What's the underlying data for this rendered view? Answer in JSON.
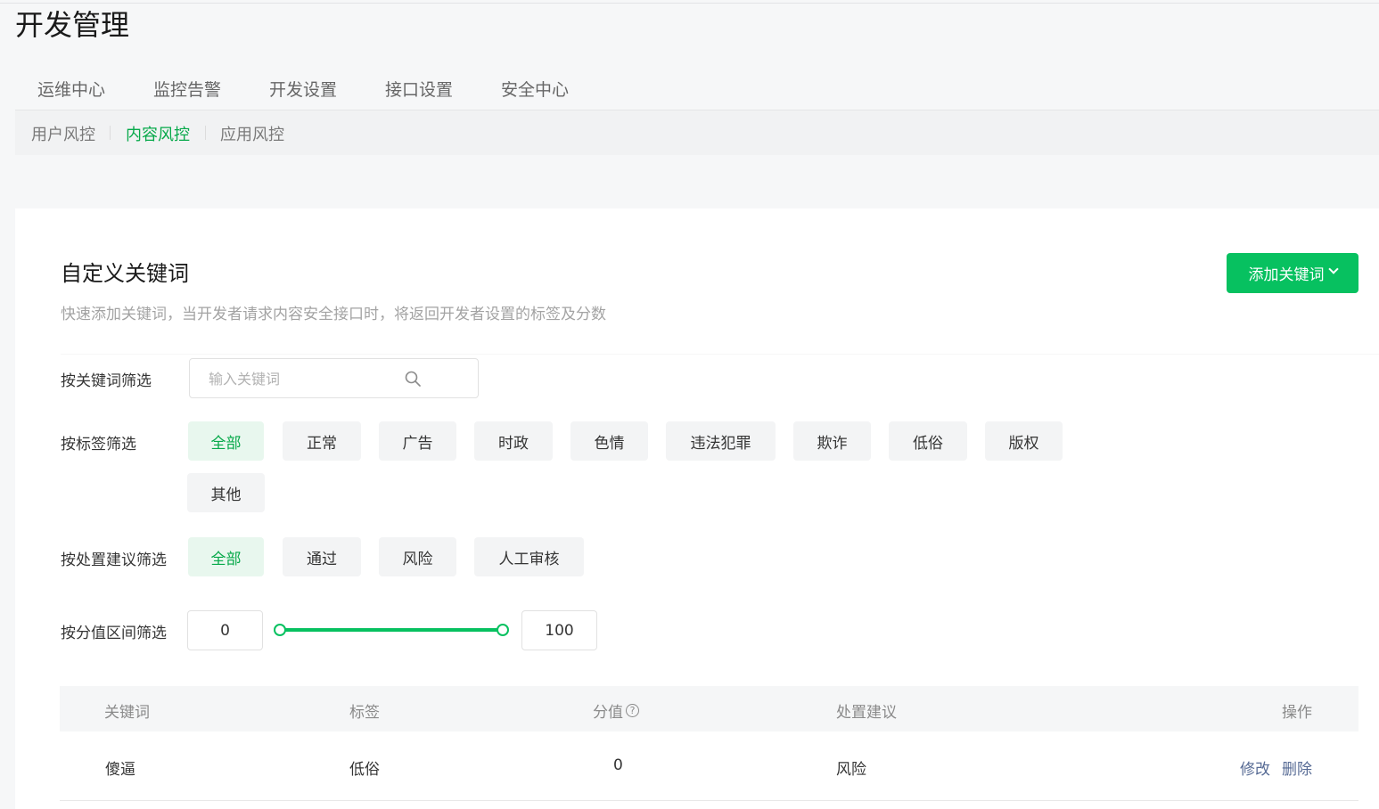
{
  "page": {
    "title": "开发管理"
  },
  "main_tabs": [
    "运维中心",
    "监控告警",
    "开发设置",
    "接口设置",
    "安全中心"
  ],
  "sub_nav": [
    {
      "label": "用户风控",
      "active": false
    },
    {
      "label": "内容风控",
      "active": true
    },
    {
      "label": "应用风控",
      "active": false
    }
  ],
  "section": {
    "title": "自定义关键词",
    "description": "快速添加关键词，当开发者请求内容安全接口时，将返回开发者设置的标签及分数",
    "add_button": "添加关键词"
  },
  "filters": {
    "keyword": {
      "label": "按关键词筛选",
      "placeholder": "输入关键词",
      "value": ""
    },
    "tags": {
      "label": "按标签筛选",
      "options": [
        "全部",
        "正常",
        "广告",
        "时政",
        "色情",
        "违法犯罪",
        "欺诈",
        "低俗",
        "版权",
        "其他"
      ],
      "selected": "全部"
    },
    "suggestion": {
      "label": "按处置建议筛选",
      "options": [
        "全部",
        "通过",
        "风险",
        "人工审核"
      ],
      "selected": "全部"
    },
    "score": {
      "label": "按分值区间筛选",
      "min": "0",
      "max": "100"
    }
  },
  "table": {
    "headers": {
      "keyword": "关键词",
      "tag": "标签",
      "score": "分值",
      "suggestion": "处置建议",
      "actions": "操作"
    },
    "rows": [
      {
        "keyword": "傻逼",
        "tag": "低俗",
        "score": "0",
        "suggestion": "风险",
        "edit": "修改",
        "delete": "删除"
      }
    ]
  },
  "colors": {
    "accent": "#07c160",
    "accent_text": "#07a94a",
    "link": "#576b95"
  },
  "icons": {
    "search": "search-icon",
    "dropdown": "chevron-down-icon",
    "help": "help-circle-icon"
  }
}
